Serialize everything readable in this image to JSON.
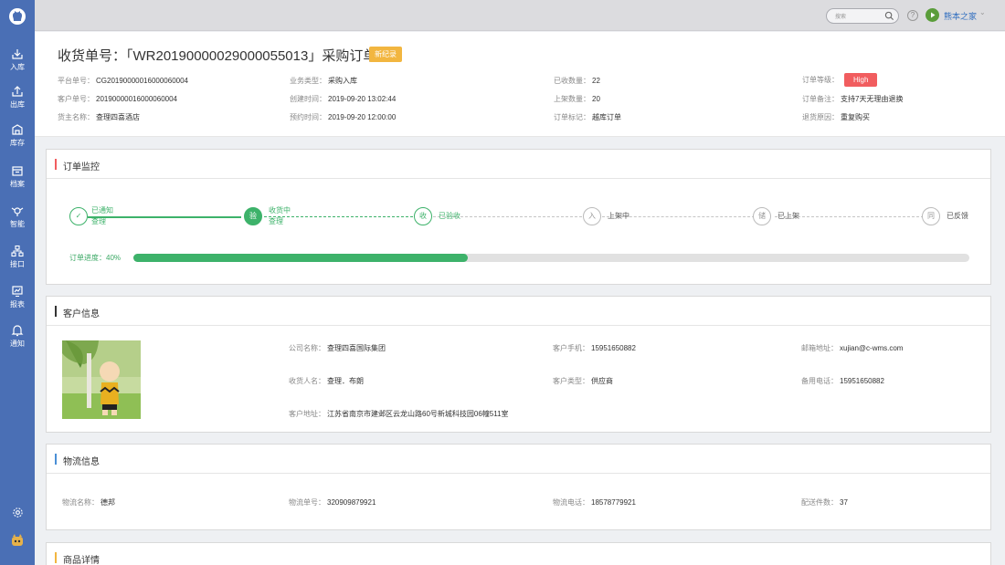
{
  "topbar": {
    "search_placeholder": "搜索",
    "user_name": "熊本之家",
    "help": "?"
  },
  "sidebar": {
    "items": [
      {
        "label": "入库",
        "icon": "inbound-icon"
      },
      {
        "label": "出库",
        "icon": "outbound-icon"
      },
      {
        "label": "库存",
        "icon": "warehouse-icon"
      },
      {
        "label": "档案",
        "icon": "archive-icon"
      },
      {
        "label": "智能",
        "icon": "smart-icon"
      },
      {
        "label": "接口",
        "icon": "api-icon"
      },
      {
        "label": "报表",
        "icon": "report-icon"
      },
      {
        "label": "通知",
        "icon": "bell-icon"
      }
    ]
  },
  "header": {
    "title": "收货单号：「WR20190000029000055013」采购订单",
    "badge": "新纪录",
    "fields": {
      "platform_no_label": "平台单号：",
      "platform_no": "CG20190000016000060004",
      "customer_no_label": "客户单号：",
      "customer_no": "20190000016000060004",
      "owner_label": "货主名称：",
      "owner": "查理四喜酒店",
      "biz_type_label": "业务类型：",
      "biz_type": "采购入库",
      "created_label": "创建时间：",
      "created": "2019-09-20 13:02:44",
      "scheduled_label": "预约时间：",
      "scheduled": "2019-09-20 12:00:00",
      "received_label": "已收数量：",
      "received": "22",
      "shelved_label": "上架数量：",
      "shelved": "20",
      "order_tag_label": "订单标记：",
      "order_tag": "越库订单",
      "level_label": "订单等级：",
      "level": "High",
      "remark_label": "订单备注：",
      "remark": "支持7天无理由退换",
      "return_reason_label": "退货原因：",
      "return_reason": "重复购买"
    }
  },
  "monitor": {
    "title": "订单监控",
    "steps": [
      {
        "icon": "✓",
        "label1": "已通知",
        "label2": "查理"
      },
      {
        "icon": "验",
        "label1": "收货中",
        "label2": "查理"
      },
      {
        "icon": "收",
        "label1": "已验收",
        "label2": ""
      },
      {
        "icon": "入",
        "label1": "上架中",
        "label2": ""
      },
      {
        "icon": "储",
        "label1": "已上架",
        "label2": ""
      },
      {
        "icon": "同",
        "label1": "已反馈",
        "label2": ""
      }
    ],
    "progress_label": "订单进度：40%",
    "progress": 0.4,
    "colors": {
      "done": "#3db26a",
      "pending": "#bbbbbb",
      "accent": "#f15d5f"
    }
  },
  "customer": {
    "title": "客户信息",
    "company_label": "公司名称：",
    "company": "查理四喜国际集团",
    "mobile_label": "客户手机：",
    "mobile": "15951650882",
    "email_label": "邮箱地址：",
    "email": "xujian@c-wms.com",
    "receiver_label": "收货人名：",
    "receiver": "查理．布朗",
    "type_label": "客户类型：",
    "type": "供应商",
    "backup_phone_label": "备用电话：",
    "backup_phone": "15951650882",
    "address_label": "客户地址：",
    "address": "江苏省南京市建邺区云龙山路60号新城科技园06幢511室"
  },
  "logistics": {
    "title": "物流信息",
    "name_label": "物流名称：",
    "name": "德邦",
    "no_label": "物流单号：",
    "no": "320909879921",
    "phone_label": "物流电话：",
    "phone": "18578779921",
    "count_label": "配送件数：",
    "count": "37"
  },
  "goods": {
    "title": "商品详情"
  }
}
